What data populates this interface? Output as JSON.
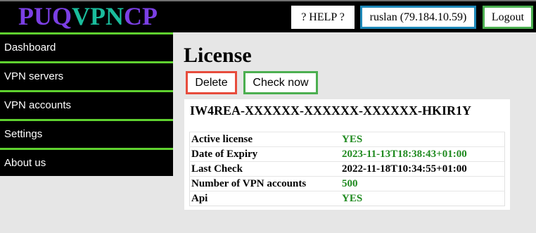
{
  "header": {
    "logo": {
      "part1": "PUQ",
      "part2": "VPN",
      "part3": "CP"
    },
    "help_label": "? HELP ?",
    "user_label": "ruslan (79.184.10.59)",
    "logout_label": "Logout"
  },
  "sidebar": {
    "items": [
      {
        "label": "Dashboard"
      },
      {
        "label": "VPN servers"
      },
      {
        "label": "VPN accounts"
      },
      {
        "label": "Settings"
      },
      {
        "label": "About us"
      }
    ]
  },
  "main": {
    "title": "License",
    "delete_label": "Delete",
    "check_label": "Check now",
    "license_key": "IW4REA-XXXXXX-XXXXXX-XXXXXX-HKIR1Y",
    "info": [
      {
        "label": "Active license",
        "value": "YES",
        "color": "green"
      },
      {
        "label": "Date of Expiry",
        "value": "2023-11-13T18:38:43+01:00",
        "color": "green"
      },
      {
        "label": "Last Check",
        "value": "2022-11-18T10:34:55+01:00",
        "color": "black"
      },
      {
        "label": "Number of VPN accounts",
        "value": "500",
        "color": "green"
      },
      {
        "label": "Api",
        "value": "YES",
        "color": "green"
      }
    ]
  },
  "colors": {
    "logo_purple": "#7b3fe4",
    "logo_teal": "#1abc9c",
    "nav_separator": "#5fd12f",
    "delete_border": "#e74c3c",
    "check_border": "#4caf50",
    "user_border": "#1e88b8",
    "value_green": "#1f8a1f"
  }
}
